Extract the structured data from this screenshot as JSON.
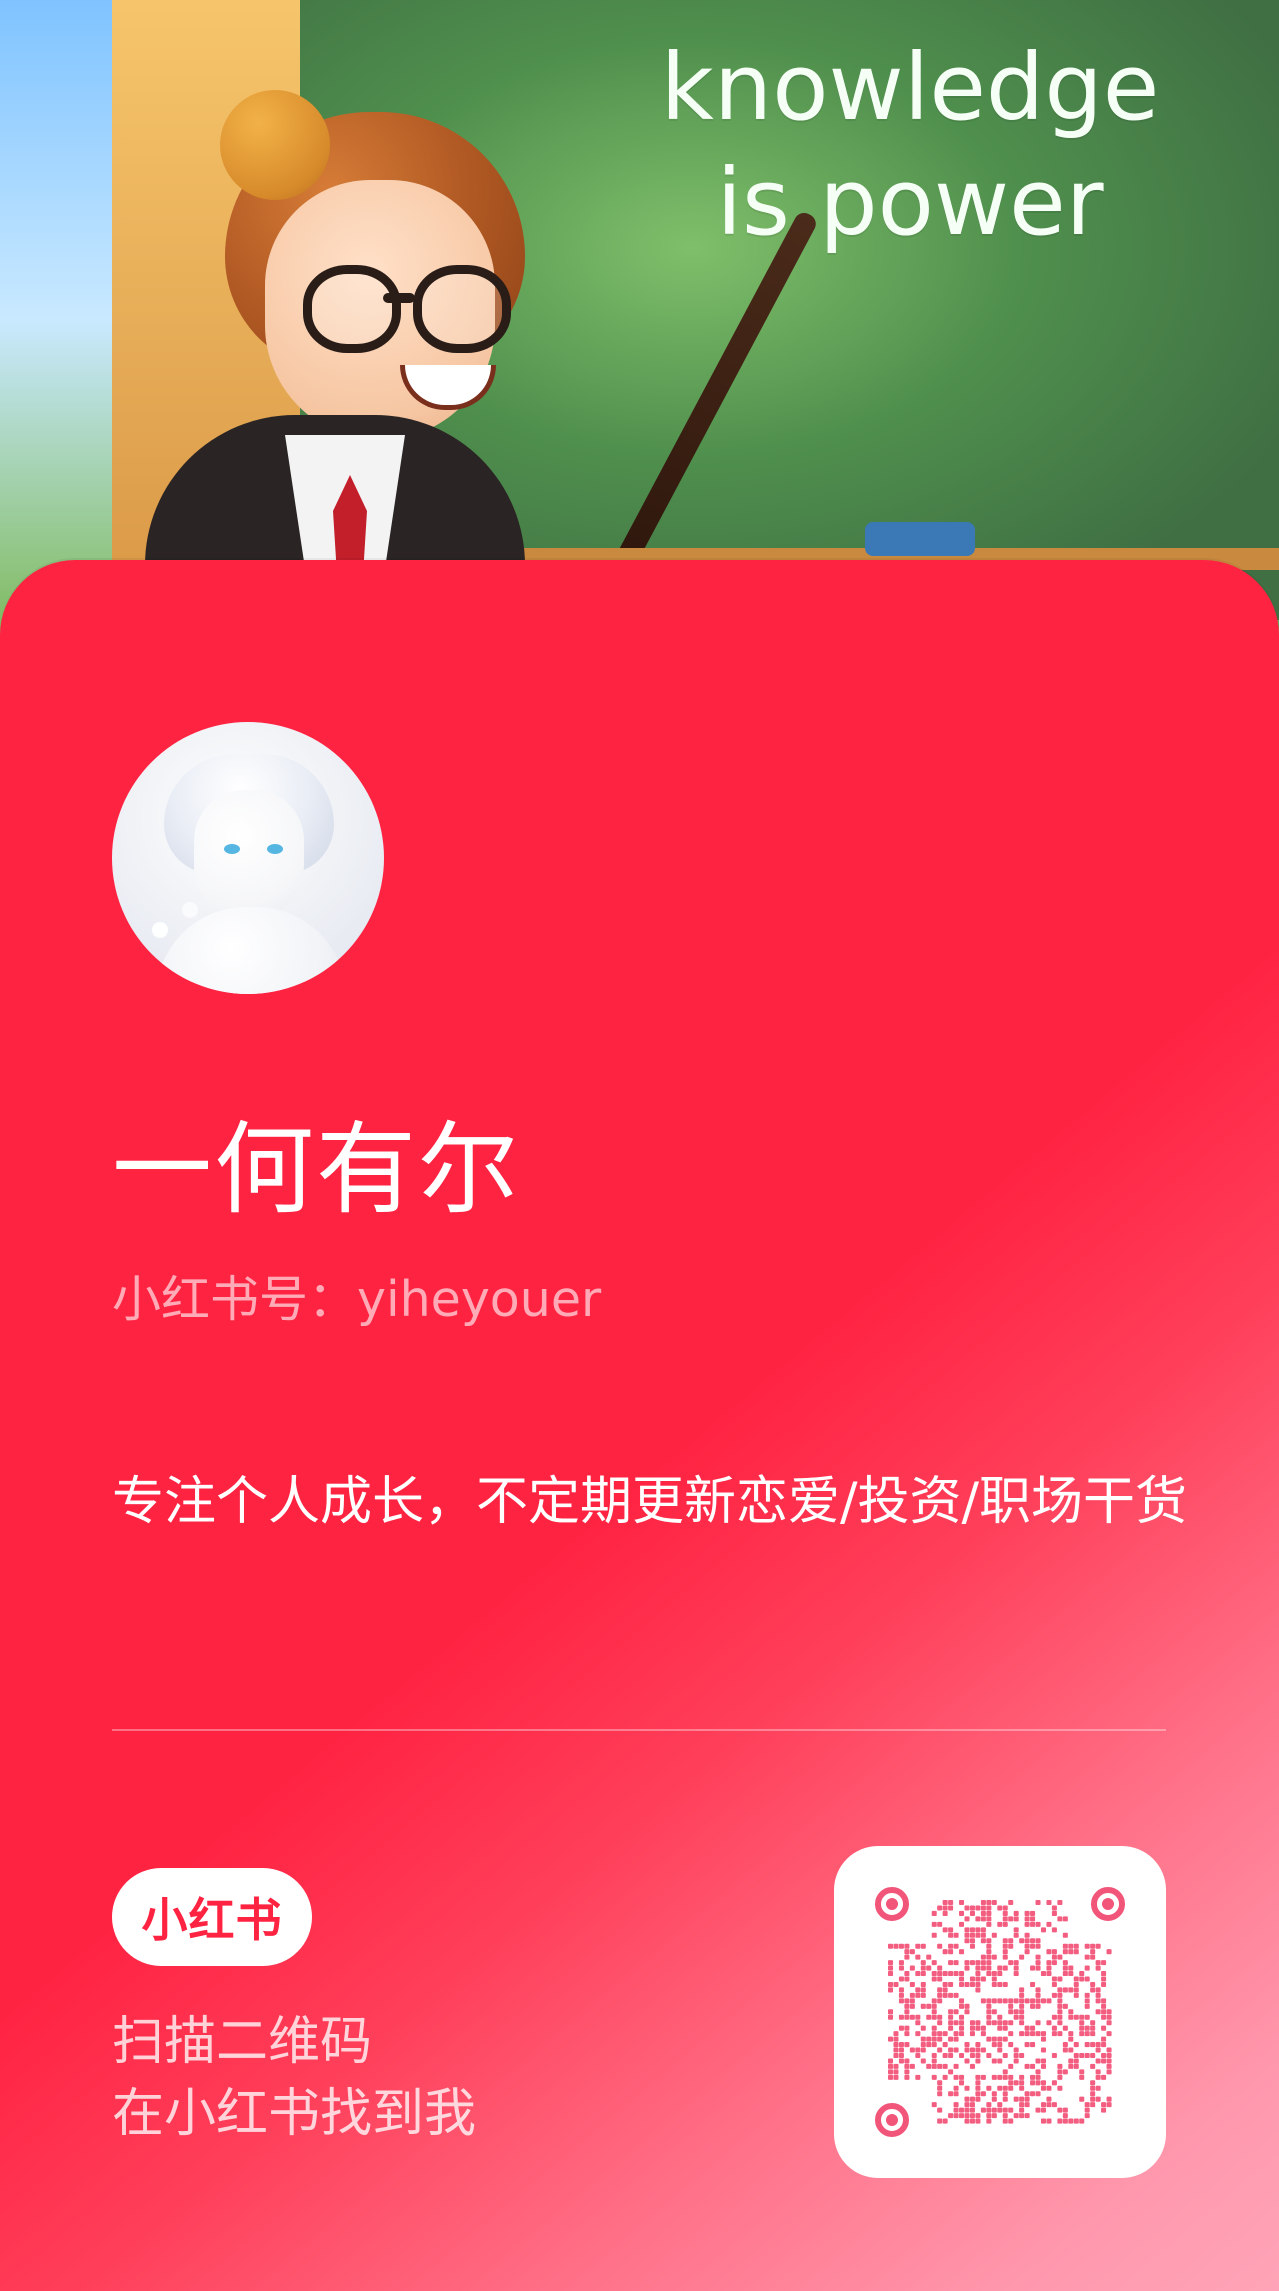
{
  "hero": {
    "chalk_line_1": "knowledge",
    "chalk_line_2": "is power"
  },
  "profile": {
    "name": "一何有尔",
    "handle": "小红书号：yiheyouer",
    "bio": "专注个人成长，不定期更新恋爱/投资/职场干货"
  },
  "footer": {
    "brand_logo_text": "小红书",
    "scan_line_1": "扫描二维码",
    "scan_line_2": "在小红书找到我"
  },
  "colors": {
    "card_red": "#ff2342",
    "card_pink": "#ffa4b8",
    "qr_pink": "#f2557a"
  },
  "icons": {
    "qr_code": "qr-code-icon",
    "avatar": "avatar-illustration"
  }
}
